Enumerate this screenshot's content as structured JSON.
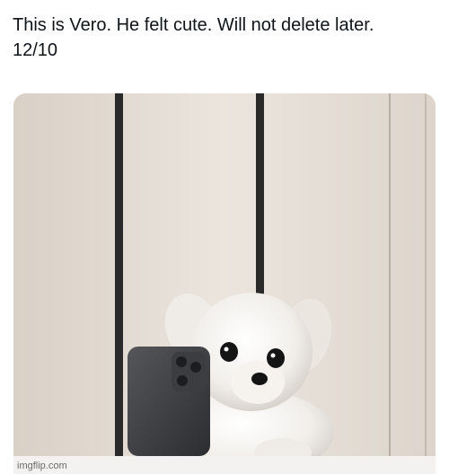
{
  "post": {
    "text_line1": "This is Vero. He felt cute. Will not delete later.",
    "text_line2": "12/10"
  },
  "media": {
    "subject": "white fluffy puppy behind a smartphone",
    "wall_color": "#e3dcd4",
    "strip_color": "#2a2a2a",
    "table_color": "#f4f2f0"
  },
  "watermark": "imgflip.com"
}
